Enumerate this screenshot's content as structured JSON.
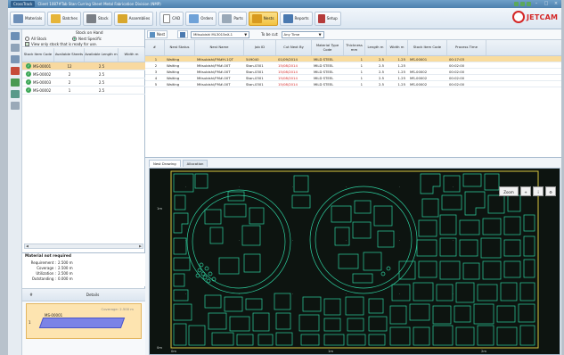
{
  "window": {
    "app_tab": "CrossTrack",
    "title": "Client 1087#Tab Stan Curring Sheet Metal Fabrication Division (NMP)"
  },
  "toolbar": {
    "buttons": [
      "Materials",
      "Batches",
      "Stock",
      "Assemblies",
      "CAD",
      "Orders",
      "Parts",
      "Nests",
      "Reports",
      "Setup"
    ],
    "active": "Nests",
    "logo": "JETCAM"
  },
  "stock": {
    "title": "Stock on Hand",
    "radio_all": "All Stock",
    "radio_specific": "Nest Specific",
    "checkbox": "View only stock that is ready for use.",
    "columns": [
      "Stock Item Code",
      "Available Sheets",
      "Available Length m",
      "Width m"
    ],
    "rows": [
      {
        "code": "MS-00001",
        "sheets": "12",
        "length": "2.5"
      },
      {
        "code": "MS-00002",
        "sheets": "2",
        "length": "2.5"
      },
      {
        "code": "MS-00003",
        "sheets": "2",
        "length": "2.5"
      },
      {
        "code": "MS-00002",
        "sheets": "1",
        "length": "2.5"
      }
    ]
  },
  "material_required": {
    "title": "Material not required",
    "fields": [
      {
        "k": "Requirement :",
        "v": "2.500 m"
      },
      {
        "k": "Coverage :",
        "v": "2.500 m"
      },
      {
        "k": "Utilization :",
        "v": "2.500 m"
      },
      {
        "k": "Outstanding :",
        "v": "0.000 m"
      }
    ]
  },
  "details": {
    "col_num": "#",
    "col_label": "Details",
    "card": {
      "num": "1",
      "code": "MS-00001",
      "coverage": "Coverage: 2.500 m"
    }
  },
  "jobs": {
    "toolbar": {
      "nest_label": "Nest",
      "machine_value": "Mitsubishi ML3015eX-1",
      "tobecut_label": "To be cut:",
      "tobecut_value": "Any Time"
    },
    "columns": [
      "#",
      "Nest Status",
      "Nest Name",
      "Job ID",
      "Cut Next By",
      "Material Type Code",
      "Thickness mm",
      "Length m",
      "Width m",
      "Stock Item Code",
      "Process Time"
    ],
    "rows": [
      {
        "idx": "1",
        "status": "Waiting",
        "name": "Mitsubishi/FM#H-1QT",
        "job": "549040",
        "out": "01/09/2014",
        "mat": "MILD STEEL",
        "thk": "1",
        "len": "2.5",
        "wid": "1.25",
        "stock": "MS-00001",
        "time": "00:17:03",
        "red": false
      },
      {
        "idx": "2",
        "status": "Waiting",
        "name": "Mitsubishi/FM#-00T",
        "job": "Stan-0301",
        "out": "15/08/2014",
        "mat": "MILD STEEL",
        "thk": "1",
        "len": "2.5",
        "wid": "1.25",
        "stock": "",
        "time": "00:02:00",
        "red": true
      },
      {
        "idx": "3",
        "status": "Waiting",
        "name": "Mitsubishi/FM#-00T",
        "job": "Stan-0301",
        "out": "15/08/2014",
        "mat": "MILD STEEL",
        "thk": "1",
        "len": "2.5",
        "wid": "1.25",
        "stock": "MS-00002",
        "time": "00:02:00",
        "red": true
      },
      {
        "idx": "4",
        "status": "Waiting",
        "name": "Mitsubishi/FM#-00T",
        "job": "Stan-0301",
        "out": "15/08/2014",
        "mat": "MILD STEEL",
        "thk": "1",
        "len": "2.5",
        "wid": "1.25",
        "stock": "MS-00002",
        "time": "00:02:00",
        "red": true
      },
      {
        "idx": "5",
        "status": "Waiting",
        "name": "Mitsubishi/FM#-00T",
        "job": "Stan-0301",
        "out": "15/08/2014",
        "mat": "MILD STEEL",
        "thk": "1",
        "len": "2.5",
        "wid": "1.25",
        "stock": "MS-00002",
        "time": "00:02:00",
        "red": true
      }
    ]
  },
  "lower": {
    "tabs": [
      "Nest Drawing",
      "Allocation"
    ],
    "active_tab": "Nest Drawing",
    "zoom_label": "Zoom",
    "axis_y": [
      "1m",
      "0m"
    ],
    "axis_x": [
      "0m",
      "1m",
      "2m"
    ]
  },
  "colors": {
    "canvas_bg": "#0d1410",
    "sheet_edge": "#d6c640",
    "part_outline": "#2fd1a0",
    "accent": "#f3c23f"
  }
}
